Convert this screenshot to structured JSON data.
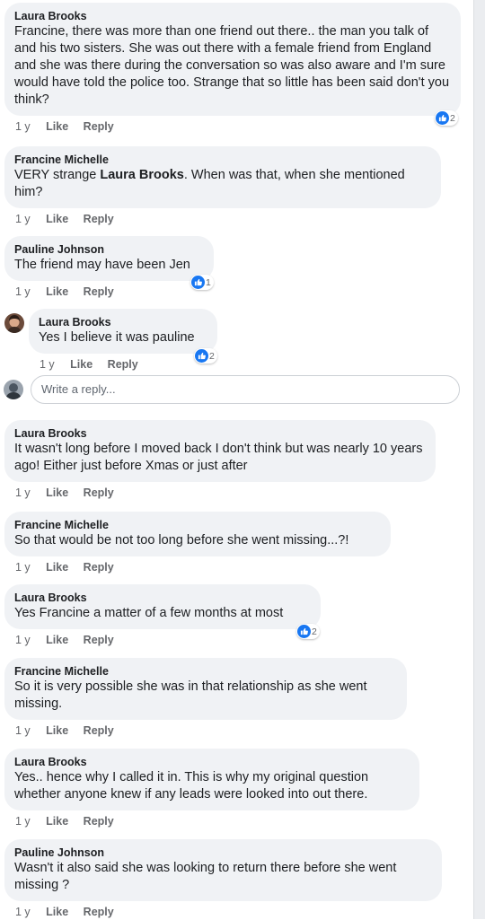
{
  "comments": [
    {
      "author": "Laura Brooks",
      "text": "Francine, there was more than one friend out there.. the man you talk of and his two sisters. She was out there with a female friend from England and she was there during the conversation so was also aware and I'm sure would have told the police too. Strange that so little has been said don't you think?",
      "time": "1 y",
      "like_label": "Like",
      "reply_label": "Reply",
      "reactions": "2"
    },
    {
      "author": "Francine Michelle",
      "text_before": "VERY strange ",
      "mention": "Laura Brooks",
      "text_after": ". When was that, when she mentioned him?",
      "time": "1 y",
      "like_label": "Like",
      "reply_label": "Reply"
    },
    {
      "author": "Pauline Johnson",
      "text": "The friend may have been Jen",
      "time": "1 y",
      "like_label": "Like",
      "reply_label": "Reply",
      "reactions": "1"
    },
    {
      "author": "Laura Brooks",
      "text": "Yes I believe it was pauline",
      "time": "1 y",
      "like_label": "Like",
      "reply_label": "Reply",
      "reactions": "2"
    },
    {
      "author": "Laura Brooks",
      "text": "It wasn't long before I moved back I don't think but was nearly  10 years ago! Either just before Xmas or just after",
      "time": "1 y",
      "like_label": "Like",
      "reply_label": "Reply"
    },
    {
      "author": "Francine Michelle",
      "text": "So that would be not too long before she went missing...?!",
      "time": "1 y",
      "like_label": "Like",
      "reply_label": "Reply"
    },
    {
      "author": "Laura Brooks",
      "text": "Yes Francine  a matter of a few months at most",
      "time": "1 y",
      "like_label": "Like",
      "reply_label": "Reply",
      "reactions": "2"
    },
    {
      "author": "Francine Michelle",
      "text": "So it is very possible she was in that relationship as she went missing.",
      "time": "1 y",
      "like_label": "Like",
      "reply_label": "Reply"
    },
    {
      "author": "Laura Brooks",
      "text": "Yes.. hence why I called it in. This is why my original question whether anyone knew if any leads were looked into out there.",
      "time": "1 y",
      "like_label": "Like",
      "reply_label": "Reply"
    },
    {
      "author": "Pauline Johnson",
      "text": "Wasn't it also said she was looking to return there before she went missing ?",
      "time": "1 y",
      "like_label": "Like",
      "reply_label": "Reply"
    }
  ],
  "reply_box": {
    "placeholder": "Write a reply..."
  },
  "colors": {
    "bubble": "#f0f2f5",
    "like_blue": "#1877f2",
    "meta_gray": "#65676b"
  },
  "icons": {
    "reaction": "thumbs-up-icon",
    "avatar": "user-avatar"
  }
}
